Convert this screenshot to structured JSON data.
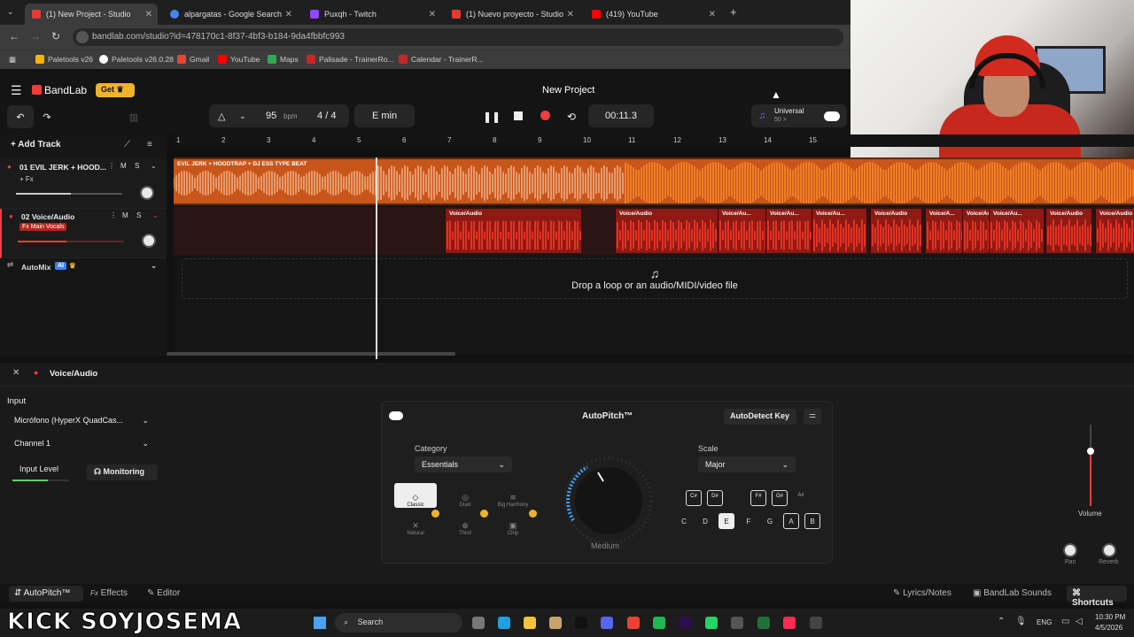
{
  "browser": {
    "tabs": [
      {
        "title": "(1) New Project - Studio",
        "color": "#e53935"
      },
      {
        "title": "alpargatas - Google Search",
        "color": "#4285f4"
      },
      {
        "title": "Puxqh - Twitch",
        "color": "#9146ff"
      },
      {
        "title": "(1) Nuevo proyecto - Studio",
        "color": "#e53935"
      },
      {
        "title": "(419) YouTube",
        "color": "#ff0000"
      }
    ],
    "url": "bandlab.com/studio?id=478170c1-8f37-4bf3-b184-9da4fbbfc993",
    "bookmarks": [
      "Paletools v26",
      "Paletools v26.0.28",
      "Gmail",
      "YouTube",
      "Maps",
      "Palisade - TrainerRo...",
      "Calendar - TrainerR..."
    ]
  },
  "app": {
    "brand": "BandLab",
    "get_label": "Get",
    "project_title": "New Project",
    "bpm": "95",
    "bpm_unit": "bpm",
    "time_sig_num": "4",
    "time_sig_sep": "/",
    "time_sig_den": "4",
    "key": "E min",
    "time": "00:11.3",
    "universal_label": "Universal",
    "universal_sub": "50 >",
    "add_track": "Add Track",
    "ruler": [
      "1",
      "2",
      "3",
      "4",
      "5",
      "6",
      "7",
      "8",
      "9",
      "10",
      "11",
      "12",
      "13",
      "14",
      "15"
    ]
  },
  "tracks": [
    {
      "name": "01  EVIL JERK + HOOD...",
      "fx": "+ Fx",
      "m": "M",
      "s": "S",
      "volume": 0.52
    },
    {
      "name": "02  Voice/Audio",
      "fx": "Fx Main Vocals",
      "m": "M",
      "s": "S",
      "volume": 0.46
    }
  ],
  "automix": {
    "label": "AutoMix",
    "badge": "AI"
  },
  "clips": {
    "beat_label": "EVIL JERK + HOODTRAP + DJ ESS TYPE BEAT",
    "voice_labels": [
      "Voice/Audio",
      "Voice/Audio",
      "Voice/Au...",
      "Voice/Au...",
      "Voice/Au...",
      "Voice/Audio",
      "Voice/A...",
      "Voice/Au...",
      "Voice/Au...",
      "Voice/Audio",
      "Voice/Audio"
    ]
  },
  "dropzone": "Drop a loop or an audio/MIDI/video file",
  "panel": {
    "track_name": "Voice/Audio",
    "input_label": "Input",
    "input_device": "Micrófono (HyperX QuadCas...",
    "channel": "Channel 1",
    "input_level": "Input Level",
    "monitoring": "Monitoring",
    "autopitch_title": "AutoPitch™",
    "autodetect": "AutoDetect Key",
    "category_label": "Category",
    "category_value": "Essentials",
    "modes": [
      "Classic",
      "Duet",
      "Big Harmony",
      "Natural",
      "Third",
      "Chip"
    ],
    "knob_label": "Medium",
    "scale_label": "Scale",
    "scale_value": "Major",
    "sharp_keys": [
      "C#\nDb",
      "D#\nEb",
      "F#\nGb",
      "G#\nAb",
      "A#\nBb"
    ],
    "keys": [
      "C",
      "D",
      "E",
      "F",
      "G",
      "A",
      "B"
    ],
    "volume_label": "Volume",
    "pan_label": "Pan",
    "reverb_label": "Reverb"
  },
  "bottom_tabs": {
    "autopitch": "AutoPitch™",
    "effects": "Effects",
    "editor": "Editor",
    "lyrics": "Lyrics/Notes",
    "sounds": "BandLab Sounds",
    "shortcuts": "Shortcuts"
  },
  "overlay": {
    "kick": "KICK SOYJOSEMA"
  },
  "taskbar": {
    "search": "Search",
    "lang": "ENG",
    "time": "10:30 PM",
    "date": "4/5/2026"
  }
}
